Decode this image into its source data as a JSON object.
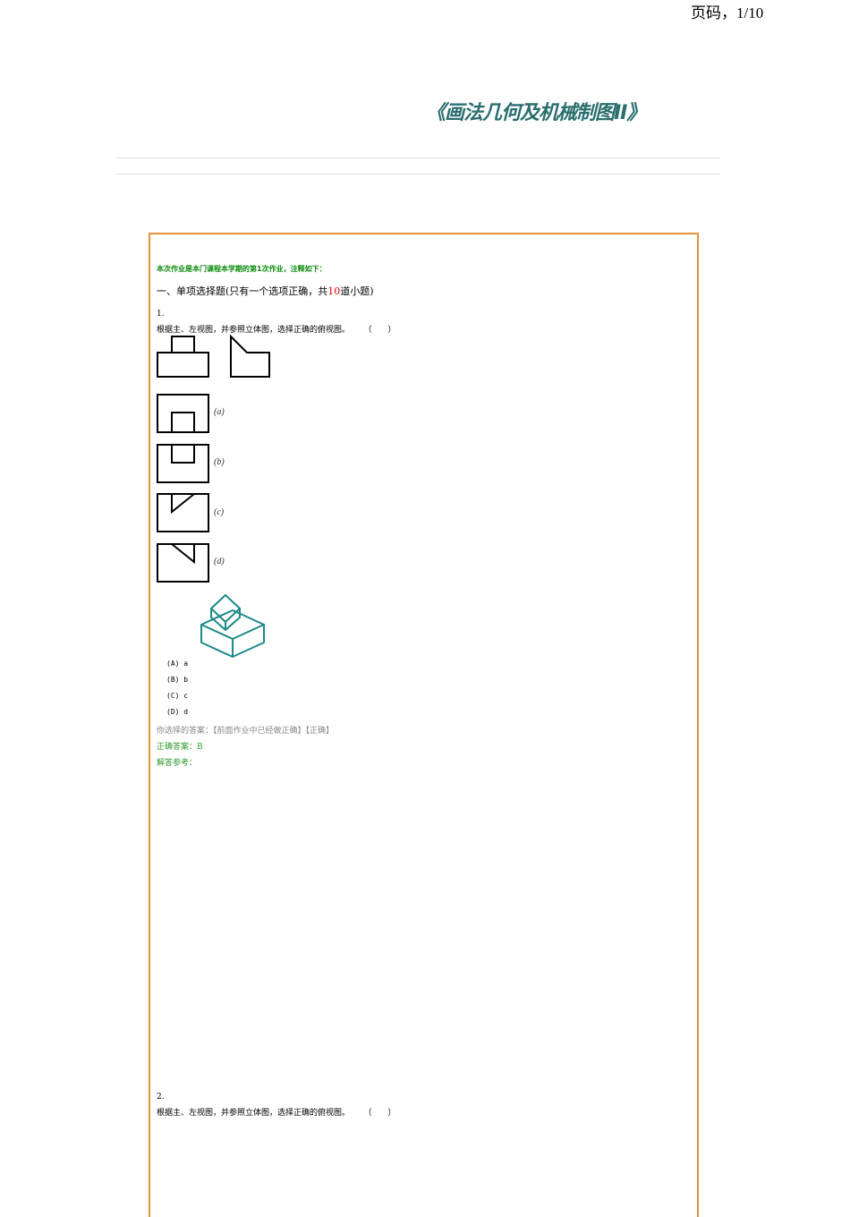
{
  "header": {
    "page_number": "页码，1/10"
  },
  "document": {
    "title": "《画法几何及机械制图II》"
  },
  "homework": {
    "notice": "本次作业是本门课程本学期的第1次作业，注释如下：",
    "section": {
      "prefix": "一、单项选择题(只有一个选项正确，共",
      "count": "10",
      "suffix": "道小题)"
    }
  },
  "questions": [
    {
      "number": "1.",
      "text": "根据主、左视图，并参照立体图，选择正确的俯视图。",
      "paren": "（　　）",
      "figure_labels": [
        "(a)",
        "(b)",
        "(c)",
        "(d)"
      ],
      "choices": [
        "(A) a",
        "(B) b",
        "(C) c",
        "(D) d"
      ],
      "your_answer": "你选择的答案：【前面作业中已经做正确】【正确】",
      "correct_answer": "正确答案：B",
      "reference": "解答参考："
    },
    {
      "number": "2.",
      "text": "根据主、左视图，并参照立体图，选择正确的俯视图。",
      "paren": "（　　）"
    }
  ]
}
